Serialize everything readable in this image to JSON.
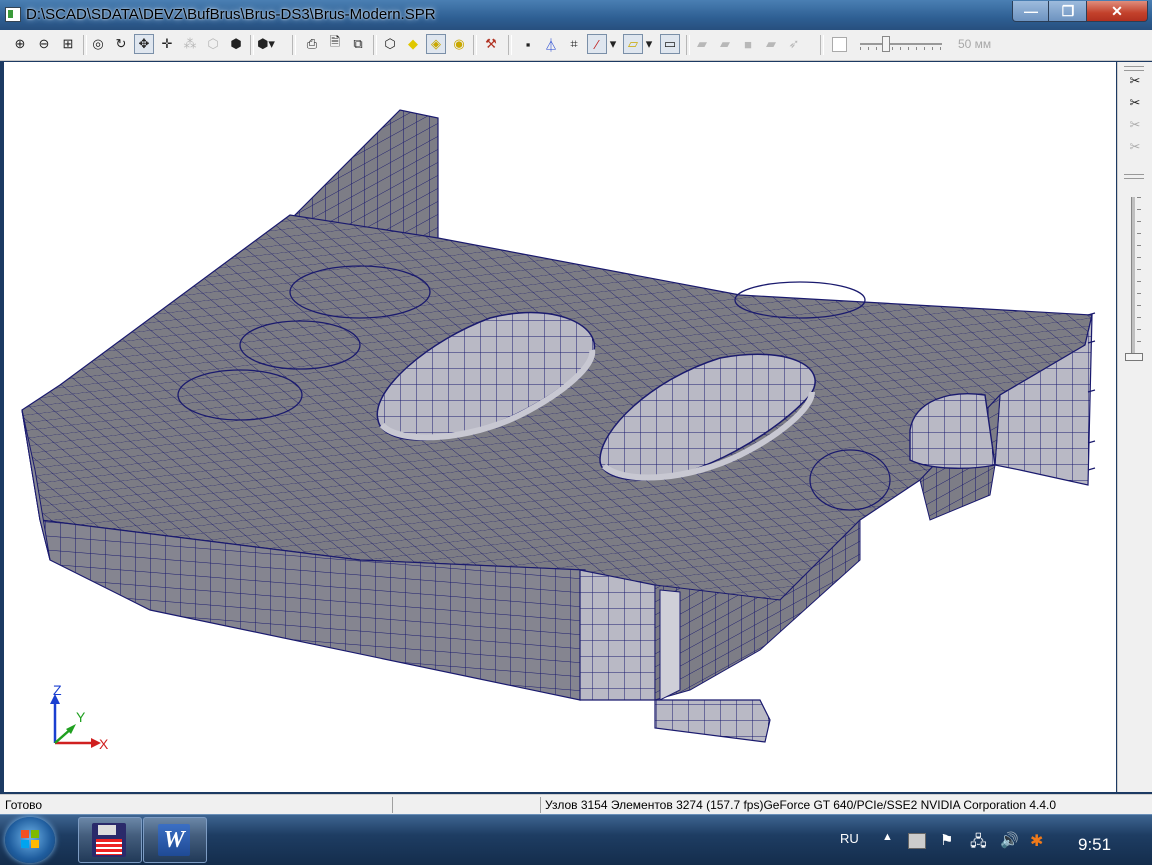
{
  "window": {
    "title": "D:\\SCAD\\SDATA\\DEVZ\\BufBrus\\Brus-DS3\\Brus-Modern.SPR",
    "min_glyph": "—",
    "max_glyph": "❐",
    "close_glyph": "✕"
  },
  "toolbar": {
    "buttons": [
      {
        "name": "zoom-in-icon",
        "glyph": "⊕"
      },
      {
        "name": "zoom-out-icon",
        "glyph": "⊖"
      },
      {
        "name": "zoom-window-icon",
        "glyph": "⊞"
      },
      {
        "name": "zoom-fit-icon",
        "glyph": "◎"
      },
      {
        "name": "rotate-icon",
        "glyph": "↻"
      },
      {
        "name": "pan-icon",
        "glyph": "✥"
      },
      {
        "name": "move-icon",
        "glyph": "✛"
      },
      {
        "name": "nodes-icon",
        "glyph": "⁂"
      },
      {
        "name": "projection-icon",
        "glyph": "⬡"
      },
      {
        "name": "box-view-icon",
        "glyph": "⬢"
      },
      {
        "name": "print-icon",
        "glyph": "⎙"
      },
      {
        "name": "preview-icon",
        "glyph": "🗎"
      },
      {
        "name": "copy-image-icon",
        "glyph": "⧉"
      },
      {
        "name": "wireframe-icon",
        "glyph": "⬡"
      },
      {
        "name": "solid-view-icon",
        "glyph": "◆"
      },
      {
        "name": "shaded-view-icon",
        "glyph": "◈"
      },
      {
        "name": "render-icon",
        "glyph": "◉"
      },
      {
        "name": "tools-icon",
        "glyph": "⚒"
      },
      {
        "name": "node-display-icon",
        "glyph": "▪"
      },
      {
        "name": "axes-display-icon",
        "glyph": "⏃"
      },
      {
        "name": "grid-display-icon",
        "glyph": "⌗"
      },
      {
        "name": "line-color-icon",
        "glyph": "⁄"
      },
      {
        "name": "fill-color-icon",
        "glyph": "▱"
      },
      {
        "name": "frame-icon",
        "glyph": "▭"
      },
      {
        "name": "section-1-icon",
        "glyph": "▰"
      },
      {
        "name": "section-2-icon",
        "glyph": "▰"
      },
      {
        "name": "section-3-icon",
        "glyph": "■"
      },
      {
        "name": "section-4-icon",
        "glyph": "▰"
      },
      {
        "name": "section-5-icon",
        "glyph": "➶"
      }
    ],
    "slider_label": "50 мм",
    "slider_fraction": 0.3
  },
  "viewport": {
    "axes": {
      "z": "Z",
      "y": "Y",
      "x": "X"
    },
    "colors": {
      "mesh_fill": "#7c7c84",
      "mesh_line": "#1a1a6e",
      "wall_fill": "#b8b8c4",
      "z_axis": "#1a3fd0",
      "y_axis": "#20a020",
      "x_axis": "#d02020"
    }
  },
  "right_panel": {
    "buttons": [
      {
        "name": "cut-tool-1-icon",
        "glyph": "✂"
      },
      {
        "name": "cut-tool-2-icon",
        "glyph": "✂"
      },
      {
        "name": "cut-tool-3-icon",
        "glyph": "✂"
      },
      {
        "name": "cut-tool-4-icon",
        "glyph": "✂"
      }
    ]
  },
  "statusbar": {
    "ready": "Готово",
    "info": "Узлов 3154  Элементов 3274  (157.7 fps)GeForce GT 640/PCIe/SSE2 NVIDIA Corporation 4.4.0"
  },
  "taskbar": {
    "language": "RU",
    "clock": "9:51",
    "tasks": [
      "scad-app",
      "word-app"
    ],
    "word_letter": "W"
  }
}
